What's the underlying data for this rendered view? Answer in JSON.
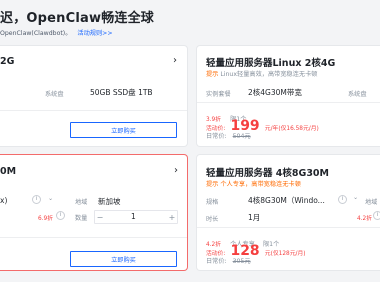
{
  "header": {
    "title": "迟，OpenClaw畅连全球",
    "subtitle": "OpenClaw(Clawdbot)。",
    "rules_link": "活动规则>>"
  },
  "card_tl": {
    "spec": "2G",
    "disk_label": "系统盘",
    "disk_value": "50GB SSD盘 1TB",
    "buy_label": "立即购买"
  },
  "card_tr": {
    "title": "轻量应用服务器Linux 2核4G",
    "tag": "提示",
    "desc": "Linux轻量高效，高带宽稳连无卡顿",
    "spec_label": "实例套餐",
    "spec_value": "2核4G30M带宽",
    "disk_label": "系统盘",
    "discount": "3.9折",
    "per": "限1个",
    "price_label": "活动价:",
    "price": "199",
    "price_unit": "元/年(仅16.58元/月)",
    "orig_label": "日常价:",
    "orig_price": "504元"
  },
  "card_bl": {
    "spec": "0M",
    "row1_left": "x)",
    "region_label": "地域",
    "region_value": "新加坡",
    "discount": "6.9折",
    "qty_label": "数量",
    "qty_minus": "−",
    "qty_value": "1",
    "qty_plus": "+",
    "buy_label": "立即购买"
  },
  "card_br": {
    "title": "轻量应用服务器 4核8G30M",
    "tag": "提示",
    "desc": "个人专享，高带宽稳连无卡顿",
    "spec_label": "规格",
    "spec_value": "4核8G30M（Windo...",
    "region_label": "地域",
    "duration_label": "时长",
    "duration_value": "1月",
    "duration_badge": "4.2折",
    "discount": "4.2折",
    "personal": "个人专享",
    "per": "限1个",
    "price_label": "活动价:",
    "price": "128",
    "price_unit": "元(仅128元/月)",
    "orig_label": "日常价:",
    "orig_price": "305元"
  }
}
